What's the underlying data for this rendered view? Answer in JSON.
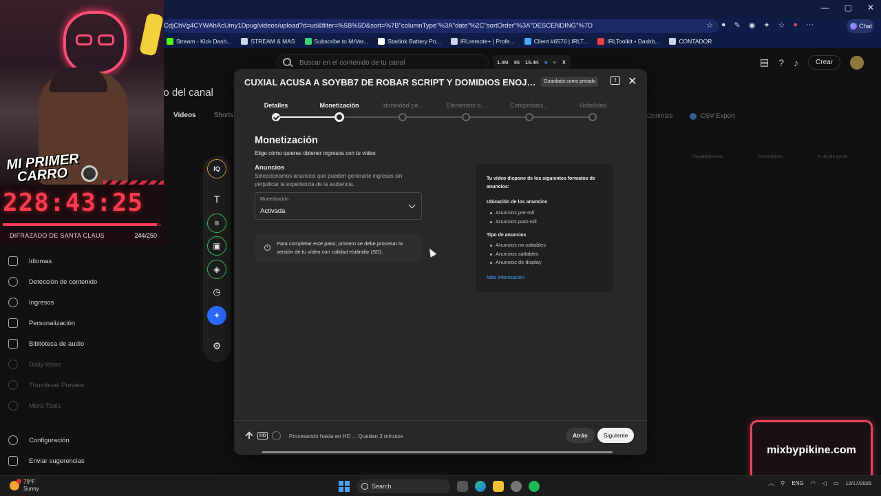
{
  "browser": {
    "url": "CdjChVg4CYWAhAcUmy1Dpug/videos/upload?d=ud&filter=%5B%5D&sort=%7B\"columnType\"%3A\"date\"%2C\"sortOrder\"%3A\"DESCENDING\"%7D",
    "chat_label": "Chat",
    "bookmarks": [
      "Stream - Kick Dash...",
      "STREAM & MAS",
      "Subscribe to MrVar...",
      "Starlink Battery Po...",
      "IRLremote+ | Profe...",
      "Client #6576 | IRLT...",
      "IRLToolkit • Dashb...",
      "CONTADOR"
    ],
    "bookmark_colors": [
      "#53fc18",
      "#cfd5e6",
      "#3bd16f",
      "#ffffff",
      "#cfd5e6",
      "#4ea4ff",
      "#ff3d3d",
      "#cfd5e6"
    ]
  },
  "studio": {
    "search_placeholder": "Buscar en el contenido de tu canal",
    "stats": [
      "1.4M",
      "95",
      "15.4K"
    ],
    "create_label": "Crear",
    "page_title": "lo del canal",
    "tabs": [
      "Videos",
      "Shorts"
    ],
    "optimize_label": "Optimize",
    "csv_label": "CSV Export",
    "col_headers": [
      "Visualizaciones",
      "Comentarios",
      "% de Me gusta"
    ],
    "nav": [
      {
        "label": "Idiomas"
      },
      {
        "label": "Detección de contenido"
      },
      {
        "label": "Ingresos"
      },
      {
        "label": "Personalización"
      },
      {
        "label": "Biblioteca de audio"
      },
      {
        "label": "Daily Ideas"
      },
      {
        "label": "Thumbnail Preview"
      },
      {
        "label": "More Tools"
      }
    ],
    "nav_bottom": [
      {
        "label": "Configuración"
      },
      {
        "label": "Enviar sugerencias"
      }
    ]
  },
  "overlay": {
    "title_line1": "MI PRIMER",
    "title_line2": "CARRO",
    "timer": "228:43:25",
    "progress_fraction": 0.976,
    "goal_label": "DIFRAZADO DE SANTA CLAUS",
    "goal_count": "244/250",
    "brand": "mixbypikine.com"
  },
  "modal": {
    "title": "CUXIAL ACUSA A SOYBB7 DE ROBAR SCRIPT Y DOMIDIOS ENOJADO CO...",
    "saved_badge": "Guardado como privado",
    "steps": [
      {
        "label": "Detalles",
        "state": "done"
      },
      {
        "label": "Monetización",
        "state": "current"
      },
      {
        "label": "Idoneidad pa...",
        "state": "todo"
      },
      {
        "label": "Elementos d...",
        "state": "todo"
      },
      {
        "label": "Comprobaci...",
        "state": "todo"
      },
      {
        "label": "Visibilidad",
        "state": "todo"
      }
    ],
    "section_title": "Monetización",
    "section_subtitle": "Elige cómo quieres obtener ingresos con tu vídeo",
    "ads_title": "Anuncios",
    "ads_description": "Seleccionamos anuncios que pueden generarte ingresos sin perjudicar la experiencia de la audiencia.",
    "select_label": "Monetización",
    "select_value": "Activada",
    "info_text": "Para completar este paso, primero se debe procesar la versión de tu vídeo con calidad estándar (SD).",
    "formats": {
      "heading": "Tu vídeo dispone de los siguientes formatos de anuncios:",
      "placement_title": "Ubicación de los anuncios",
      "placement": [
        "Anuncios pre-roll",
        "Anuncios post-roll"
      ],
      "types_title": "Tipo de anuncios",
      "types": [
        "Anuncios no saltables",
        "Anuncios saltables",
        "Anuncios de display"
      ],
      "more_link": "Más información"
    },
    "footer_status": "Procesando hasta en HD ... Quedan 3 minutos",
    "hd_badge": "HD",
    "back_label": "Atrás",
    "next_label": "Siguiente"
  },
  "toolrail": {
    "iq_label": "IQ",
    "text_glyph": "T"
  },
  "taskbar": {
    "temperature": "79°F",
    "condition": "Sunny",
    "search_label": "Search",
    "lang": "ENG",
    "date": "12/17/2025"
  }
}
